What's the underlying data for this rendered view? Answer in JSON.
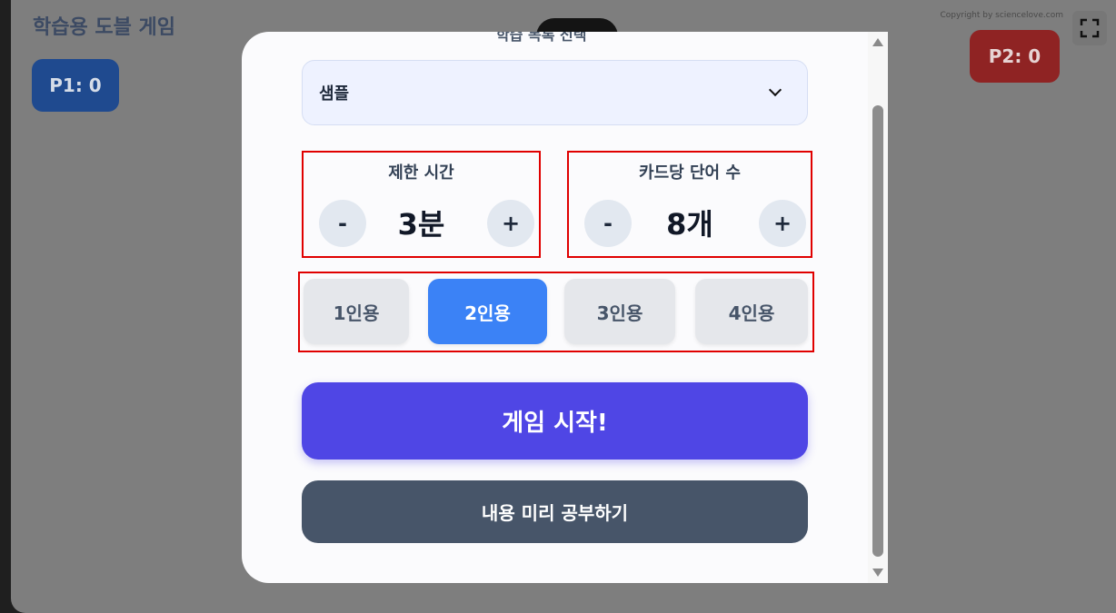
{
  "app": {
    "title": "학습용 도블 게임",
    "copyright": "Copyright by sciencelove.com"
  },
  "scores": {
    "p1": "P1: 0",
    "p2": "P2: 0"
  },
  "modal": {
    "cut_heading": "학습 목록 선택",
    "select_value": "샘플",
    "time_setting": {
      "label": "제한 시간",
      "value": "3분",
      "minus": "-",
      "plus": "+"
    },
    "words_setting": {
      "label": "카드당 단어 수",
      "value": "8개",
      "minus": "-",
      "plus": "+"
    },
    "player_options": [
      "1인용",
      "2인용",
      "3인용",
      "4인용"
    ],
    "selected_player_option": "2인용",
    "start_button": "게임 시작!",
    "study_button": "내용 미리 공부하기"
  },
  "icons": {
    "fullscreen": "fullscreen-icon",
    "select_arrow": "chevron-down-icon"
  },
  "colors": {
    "primary": "#4f46e5",
    "selected_option": "#3b82f6",
    "secondary_button": "#475569",
    "highlight_border": "#e00000"
  }
}
